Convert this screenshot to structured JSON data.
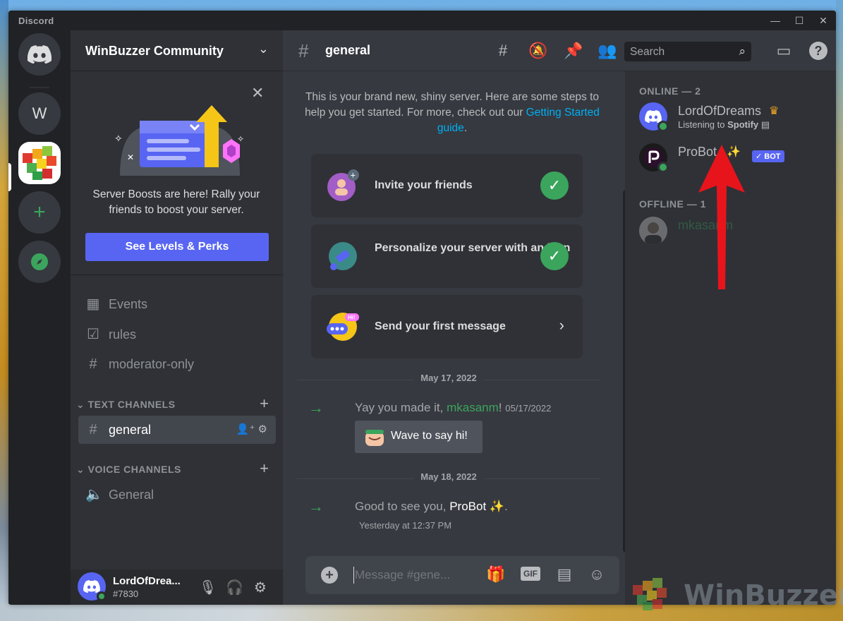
{
  "app": {
    "title": "Discord"
  },
  "window_controls": {
    "minimize": "—",
    "maximize": "☐",
    "close": "✕"
  },
  "rail": {
    "server_initial": "W"
  },
  "server": {
    "name": "WinBuzzer Community"
  },
  "boost": {
    "text": "Server Boosts are here! Rally your friends to boost your server.",
    "button": "See Levels & Perks"
  },
  "channels": {
    "top": [
      {
        "label": "Events",
        "icon": "calendar-icon"
      },
      {
        "label": "rules",
        "icon": "checkbox-icon"
      },
      {
        "label": "moderator-only",
        "icon": "locked-hash-icon"
      }
    ],
    "text_category": "TEXT CHANNELS",
    "text": [
      {
        "label": "general",
        "icon": "hash-icon"
      }
    ],
    "voice_category": "VOICE CHANNELS",
    "voice": [
      {
        "label": "General",
        "icon": "speaker-icon"
      }
    ]
  },
  "user": {
    "name": "LordOfDrea...",
    "tag": "#7830"
  },
  "header": {
    "channel": "general",
    "search_placeholder": "Search"
  },
  "intro": {
    "text": "This is your brand new, shiny server. Here are some steps to help you get started. For more, check out our",
    "link": "Getting Started guide",
    "end": "."
  },
  "cards": [
    {
      "text": "Invite your friends",
      "done": true
    },
    {
      "text": "Personalize your server with an icon",
      "done": true
    },
    {
      "text": "Send your first message",
      "done": false
    }
  ],
  "messages": [
    {
      "date": "May 17, 2022",
      "prefix": "Yay you made it, ",
      "user": "mkasanm",
      "suffix": "!",
      "time": "05/17/2022",
      "button": "Wave to say hi!"
    },
    {
      "date": "May 18, 2022",
      "prefix": "Good to see you, ",
      "user": "ProBot",
      "emoji": "✨",
      "suffix": ".",
      "time": "Yesterday at 12:37 PM"
    }
  ],
  "composer": {
    "placeholder": "Message #gene..."
  },
  "members": {
    "online_header": "ONLINE — 2",
    "offline_header": "OFFLINE — 1",
    "online": [
      {
        "name": "LordOfDreams",
        "badge": "crown-icon",
        "sub_prefix": "Listening to ",
        "sub_app": "Spotify"
      },
      {
        "name": "ProBot",
        "badge": "sparkles",
        "tag": "✓ BOT"
      }
    ],
    "offline": [
      {
        "name": "mkasanm"
      }
    ]
  },
  "watermark": {
    "text": "WinBuzzer"
  },
  "colors": {
    "blurple": "#5865f2",
    "green": "#3ba55d",
    "link": "#00aff4",
    "arrow": "#e8141c"
  }
}
